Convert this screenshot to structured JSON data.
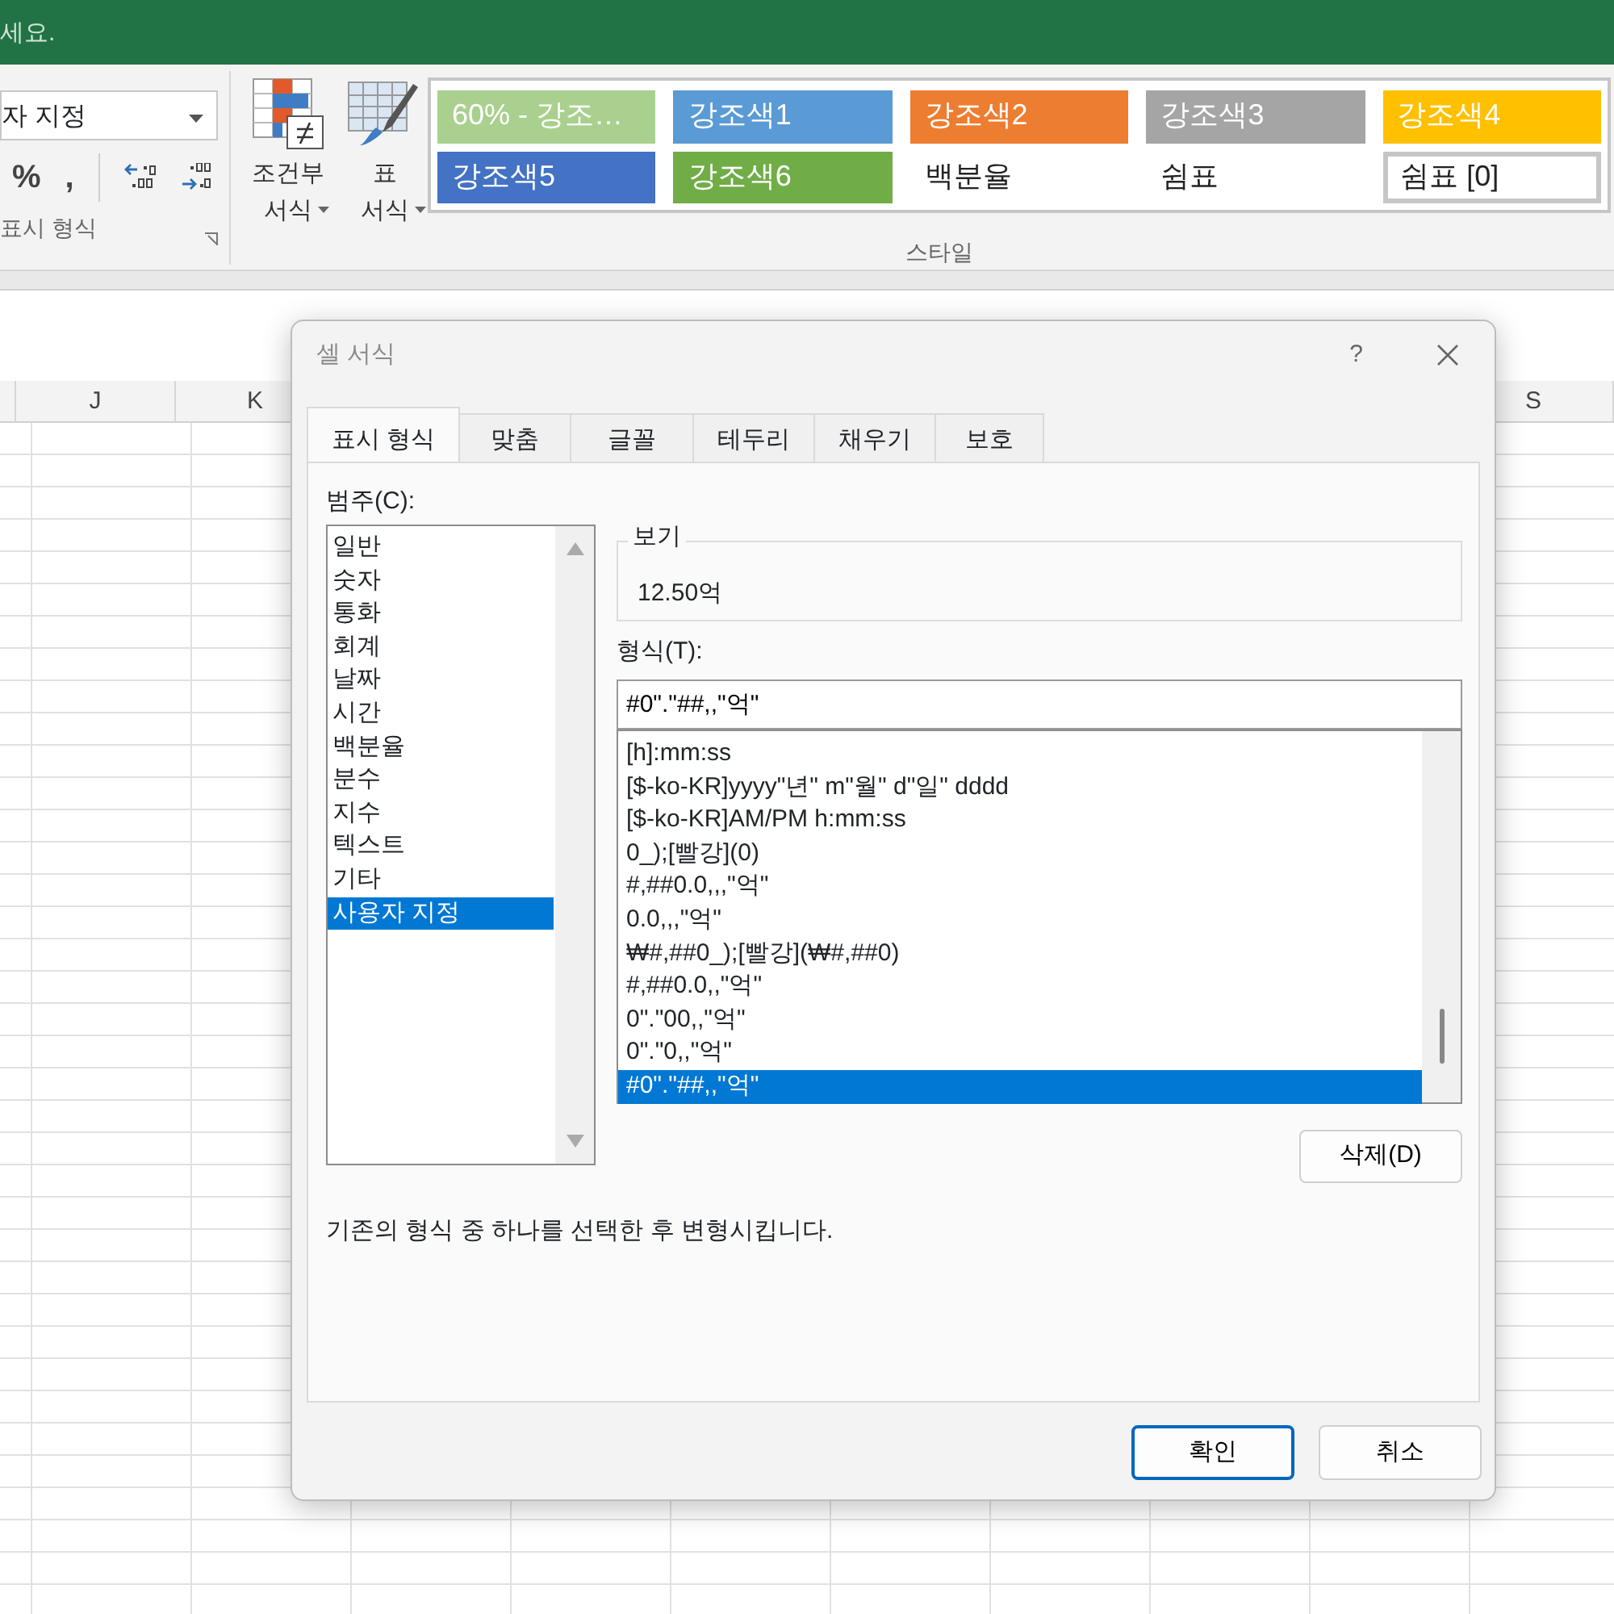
{
  "title_bar": {
    "text": "세요."
  },
  "ribbon": {
    "number_format": {
      "value": "자 지정",
      "group_label": "표시 형식",
      "buttons": [
        "%",
        ","
      ]
    },
    "format_buttons": [
      {
        "kind": "conditional",
        "label": "조건부\n서식"
      },
      {
        "kind": "table",
        "label": "표\n서식"
      }
    ],
    "styles": {
      "label": "스타일",
      "items": [
        {
          "label": "60% - 강조…",
          "color": "#a9d08e",
          "selected": false
        },
        {
          "label": "강조색1",
          "color": "#5b9bd5",
          "selected": false
        },
        {
          "label": "강조색2",
          "color": "#ed7d31",
          "selected": false
        },
        {
          "label": "강조색3",
          "color": "#a5a5a5",
          "selected": false
        },
        {
          "label": "강조색4",
          "color": "#ffc000",
          "selected": false
        },
        {
          "label": "강조색5",
          "color": "#4472c4",
          "selected": false
        },
        {
          "label": "강조색6",
          "color": "#70ad47",
          "selected": false
        },
        {
          "label": "백분율",
          "selected": false
        },
        {
          "label": "쉼표",
          "selected": false
        },
        {
          "label": "쉼표 [0]",
          "selected": true
        }
      ]
    }
  },
  "sheet": {
    "columns": [
      "J",
      "K",
      "S"
    ]
  },
  "dialog": {
    "title": "셀 서식",
    "help": "?",
    "tabs": [
      {
        "label": "표시 형식",
        "selected": true
      },
      {
        "label": "맞춤",
        "selected": false
      },
      {
        "label": "글꼴",
        "selected": false
      },
      {
        "label": "테두리",
        "selected": false
      },
      {
        "label": "채우기",
        "selected": false
      },
      {
        "label": "보호",
        "selected": false
      }
    ],
    "category_label": "범주(C):",
    "categories": [
      {
        "label": "일반",
        "selected": false
      },
      {
        "label": "숫자",
        "selected": false
      },
      {
        "label": "통화",
        "selected": false
      },
      {
        "label": "회계",
        "selected": false
      },
      {
        "label": "날짜",
        "selected": false
      },
      {
        "label": "시간",
        "selected": false
      },
      {
        "label": "백분율",
        "selected": false
      },
      {
        "label": "분수",
        "selected": false
      },
      {
        "label": "지수",
        "selected": false
      },
      {
        "label": "텍스트",
        "selected": false
      },
      {
        "label": "기타",
        "selected": false
      },
      {
        "label": "사용자 지정",
        "selected": true
      }
    ],
    "sample": {
      "label": "보기",
      "value": "12.50억"
    },
    "type_label": "형식(T):",
    "type_value": "#0\".\"##,,\"억\"",
    "formats": [
      {
        "label": "[h]:mm:ss",
        "selected": false
      },
      {
        "label": "[$-ko-KR]yyyy\"년\" m\"월\" d\"일\" dddd",
        "selected": false
      },
      {
        "label": "[$-ko-KR]AM/PM h:mm:ss",
        "selected": false
      },
      {
        "label": "0_);[빨강](0)",
        "selected": false
      },
      {
        "label": "#,##0.0,,,\"억\"",
        "selected": false
      },
      {
        "label": "0.0,,,\"억\"",
        "selected": false
      },
      {
        "label": "₩#,##0_);[빨강](₩#,##0)",
        "selected": false
      },
      {
        "label": "#,##0.0,,\"억\"",
        "selected": false
      },
      {
        "label": "0\".\"00,,\"억\"",
        "selected": false
      },
      {
        "label": "0\".\"0,,\"억\"",
        "selected": false
      },
      {
        "label": "#0\".\"##,,\"억\"",
        "selected": true
      }
    ],
    "delete_button": "삭제(D)",
    "description": "기존의 형식 중 하나를 선택한 후 변형시킵니다.",
    "buttons": [
      {
        "label": "확인",
        "kind": "default"
      },
      {
        "label": "취소",
        "kind": "normal"
      }
    ]
  }
}
